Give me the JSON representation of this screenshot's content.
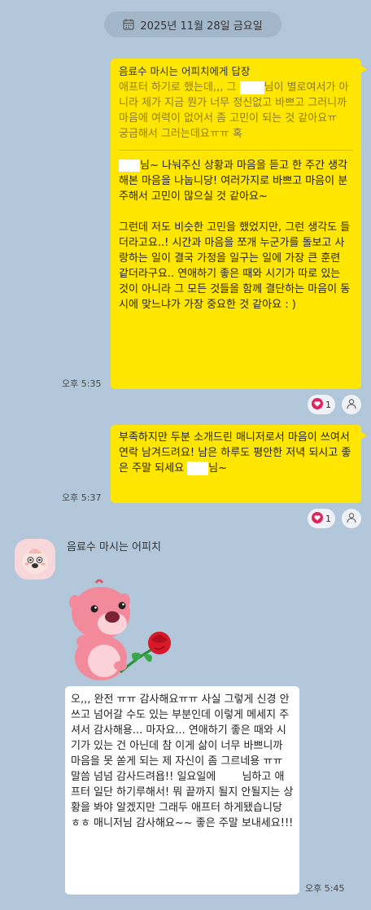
{
  "date_divider": {
    "text": "2025년 11월 28일 금요일"
  },
  "messages": {
    "m1": {
      "reply_header": "음료수 마시는 어피치에게 답장",
      "quote_part1": "애프터 하기로 했는데,,, 그 ",
      "quote_part2": "님이 별로여서가 아니라 제가 지금 뭔가 너무 정신없고 바쁘고 그러니까 마음에 여력이 없어서 좀 고민이 되는 것 같아요ㅠ\n궁금해서 그러는데요ㅠㅠ 혹",
      "body_part1": "님~ 나눠주신 상황과 마음을 듣고 한 주간 생각해본 마음을 나눕니당! 여러가지로 바쁘고 마음이 분주해서 고민이 많으실 것 같아요~\n\n그런데 저도 비슷한 고민을 했었지만, 그런 생각도 들더라고요..! 시간과 마음을 쪼개 누군가를 돌보고 사랑하는 일이 결국 가정을 일구는 일에 가장 큰 훈련 같더라구요.. 연애하기 좋은 때와 시기가 따로 있는 것이 아니라 그 모든 것들을 함께 결단하는 마음이 동시에 맞느냐가 가장 중요한 것 같아요 : )",
      "time": "오후 5:35",
      "reaction_count": "1"
    },
    "m2": {
      "body_part1": "부족하지만 두분 소개드린 매니저로서 마음이 쓰여서 연락 남겨드려요! 남은 하루도 평안한 저녁 되시고 좋은 주말 되세요 ",
      "body_part2": "님~",
      "time": "오후 5:37",
      "reaction_count": "1"
    },
    "m3": {
      "sender": "음료수 마시는 어피치",
      "body_part1": "오,,, 완전 ㅠㅠ 감사해요ㅠㅠ 사실 그렇게 신경 안쓰고 넘어갈 수도 있는 부분인데 이렇게 메세지 주셔서 감사해용... 마자요... 연애하기 좋은 때와 시기가 있는 건 아닌데 참 이게 삶이 너무 바쁘니까 마음을 못 쏟게 되는 제 자신이 좀 그르네용 ㅠㅠ\n말씀 넘넘 감사드려욥!! 일요일에 ",
      "body_part2": "님하고 애프터 일단 하기루해서! 뭐 끝까지 될지 안될지는 상황을 봐야 알겠지만 그래두 애프터 하게됐습니당 ㅎㅎ 매니저님 감사해요~~ 좋은 주말 보내세요!!!",
      "time": "오후 5:45"
    }
  },
  "colors": {
    "background": "#b2c7da",
    "my_bubble": "#ffe600",
    "their_bubble": "#ffffff",
    "heart": "#e0245e"
  }
}
